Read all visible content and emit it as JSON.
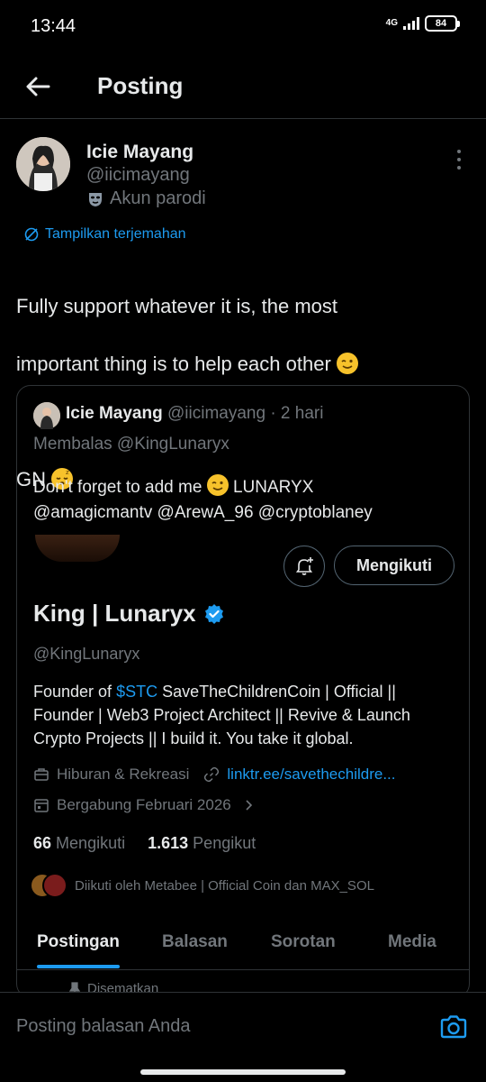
{
  "status_bar": {
    "time": "13:44",
    "network": "4G",
    "battery": "84"
  },
  "header": {
    "title": "Posting",
    "back_icon": "arrow-left-icon"
  },
  "post": {
    "author_name": "Icie Mayang",
    "author_handle": "@iicimayang",
    "parody_label": "Akun parodi",
    "translate_label": "Tampilkan terjemahan",
    "text_line1": "Fully support whatever it is, the most",
    "text_line2": "important thing is to help each other",
    "text_line3": "GN"
  },
  "quote": {
    "author_name": "Icie Mayang",
    "meta": "@iicimayang · 2 hari",
    "reply_to": "Membalas @KingLunaryx",
    "text_line1": "Don't forget to add me",
    "text_line1_tail": "LUNARYX",
    "text_line2": "@amagicmantv @ArewA_96 @cryptoblaney",
    "profile": {
      "follow_label": "Mengikuti",
      "name": "King | Lunaryx",
      "handle": "@KingLunaryx",
      "bio_prefix": "Founder of ",
      "bio_link": "$STC",
      "bio_rest": " SaveTheChildrenCoin | Official || Founder | Web3 Project Architect || Revive & Launch Crypto Projects || I build it. You take it global.",
      "category": "Hiburan & Rekreasi",
      "link": "linktr.ee/savethechildre...",
      "joined": "Bergabung Februari 2026",
      "following_count": "66",
      "following_label": "Mengikuti",
      "followers_count": "1.613",
      "followers_label": "Pengikut",
      "followed_by": "Diikuti oleh Metabee | Official Coin dan MAX_SOL",
      "tabs": [
        "Postingan",
        "Balasan",
        "Sorotan",
        "Media"
      ],
      "pinned_label": "Disematkan"
    }
  },
  "reply_bar": {
    "placeholder": "Posting balasan Anda"
  },
  "colors": {
    "background": "#000000",
    "text": "#e7e9ea",
    "muted": "#71767b",
    "accent": "#1d9bf0",
    "border": "#2f3336"
  }
}
